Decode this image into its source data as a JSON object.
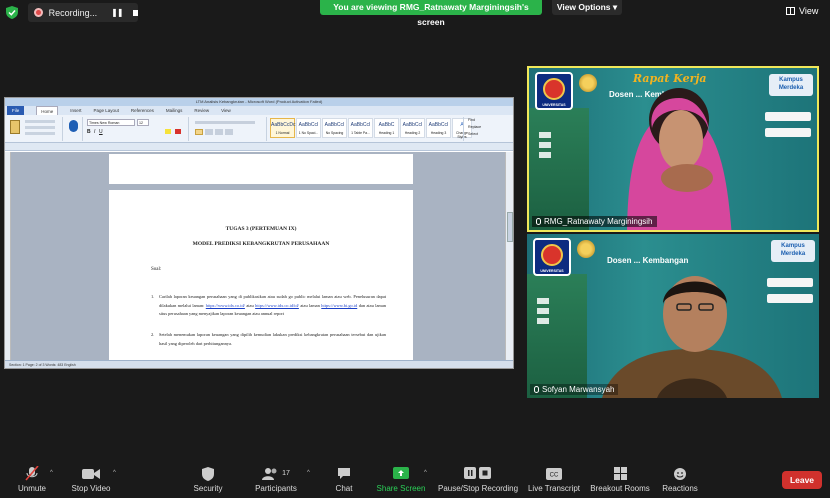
{
  "top_bar": {
    "recording_label": "Recording...",
    "viewing_banner": "You are viewing RMG_Ratnawaty Marginingsih's screen",
    "view_options": "View Options",
    "view_label": "View"
  },
  "word": {
    "title": "LTM Analisis Kebangkrutan - Microsoft Word (Product Activation Failed)",
    "tabs": [
      "File",
      "Home",
      "Insert",
      "Page Layout",
      "References",
      "Mailings",
      "Review",
      "View"
    ],
    "font_name": "Times New Roman",
    "font_size": "12",
    "styles": [
      {
        "preview": "AaBbCcDc",
        "name": "1 Normal"
      },
      {
        "preview": "AaBbCcI",
        "name": "1 No Spaci..."
      },
      {
        "preview": "AaBbCcI",
        "name": "No Spacing"
      },
      {
        "preview": "AaBbCcI",
        "name": "1 Table Pa..."
      },
      {
        "preview": "AaBbC",
        "name": "Heading 1"
      },
      {
        "preview": "AaBbCcI",
        "name": "Heading 2"
      },
      {
        "preview": "AaBbCcI",
        "name": "Heading 3"
      }
    ],
    "change_styles": "Change Styles",
    "find": "Find",
    "replace": "Replace",
    "select": "Select",
    "doc_title_1": "TUGAS 3 (PERTEMUAN IX)",
    "doc_title_2": "MODEL PREDIKSI KEBANGKRUTAN PERUSAHAAN",
    "soal_label": "Soal:",
    "item1_number": "1.",
    "item1_text_a": "Carilah laporan keuangan perusahaan yang di publikasikan atau sudah go public melalui laman atau web. Penelusuran dapat dilakukan melalui laman:",
    "item1_link1": "https://www.idx.co.id/",
    "item1_text_b": "atau",
    "item1_link2": "https://www.idx.co.id/id/",
    "item1_text_c": "atau laman",
    "item1_link3": "https://www.bi.go.id",
    "item1_text_d": "dan atau laman situs perusahaan yang menyajikan laporan keuangan atau annual report",
    "item2_number": "2.",
    "item2_text": "Setelah menemukan laporan keuangan yang dipilih kemudian lakukan prediksi kebangkrutan perusahaan tersebut dan ujikan hasil yang diperoleh dari perhitungannya.",
    "status": "Section: 1   Page: 2 of 3   Words: 483   English"
  },
  "tiles": [
    {
      "participant": "RMG_Ratnawaty Marginingsih",
      "banner_title": "Rapat Kerja",
      "banner_subtitle": "Dosen ... Kembangan",
      "badge": "Kampus Merdeka",
      "logo_label": "UNIVERSITAS",
      "speaking": true
    },
    {
      "participant": "Sofyan Marwansyah",
      "banner_title": "",
      "banner_subtitle": "Dosen ... Kembangan",
      "badge": "Kampus Merdeka",
      "logo_label": "UNIVERSITAS",
      "speaking": false
    }
  ],
  "toolbar": {
    "unmute": "Unmute",
    "stop_video": "Stop Video",
    "security": "Security",
    "participants": "Participants",
    "participants_count": "17",
    "chat": "Chat",
    "share_screen": "Share Screen",
    "pause_stop_recording": "Pause/Stop Recording",
    "live_transcript": "Live Transcript",
    "breakout_rooms": "Breakout Rooms",
    "reactions": "Reactions",
    "leave": "Leave"
  },
  "colors": {
    "viewing_green": "#2bb34a",
    "leave_red": "#d0312d",
    "speaker_border": "#f0e85a",
    "share_green": "#2bb34a"
  }
}
